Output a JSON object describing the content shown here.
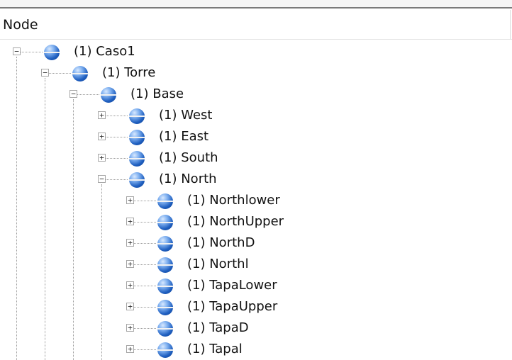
{
  "header": {
    "column_label": "Node"
  },
  "tree": {
    "rows": [
      {
        "label": "(1) Caso1",
        "expander": "−",
        "level": 0
      },
      {
        "label": "(1) Torre",
        "expander": "−",
        "level": 1
      },
      {
        "label": "(1) Base",
        "expander": "−",
        "level": 2
      },
      {
        "label": "(1) West",
        "expander": "+",
        "level": 3
      },
      {
        "label": "(1) East",
        "expander": "+",
        "level": 3
      },
      {
        "label": "(1) South",
        "expander": "+",
        "level": 3
      },
      {
        "label": "(1) North",
        "expander": "−",
        "level": 3
      },
      {
        "label": "(1) Northlower",
        "expander": "+",
        "level": 4
      },
      {
        "label": "(1) NorthUpper",
        "expander": "+",
        "level": 4
      },
      {
        "label": "(1) NorthD",
        "expander": "+",
        "level": 4
      },
      {
        "label": "(1) Northl",
        "expander": "+",
        "level": 4
      },
      {
        "label": "(1) TapaLower",
        "expander": "+",
        "level": 4
      },
      {
        "label": "(1) TapaUpper",
        "expander": "+",
        "level": 4
      },
      {
        "label": "(1) TapaD",
        "expander": "+",
        "level": 4
      },
      {
        "label": "(1) Tapal",
        "expander": "+",
        "level": 4
      }
    ]
  },
  "icons": {
    "node": "sphere-node-icon"
  }
}
